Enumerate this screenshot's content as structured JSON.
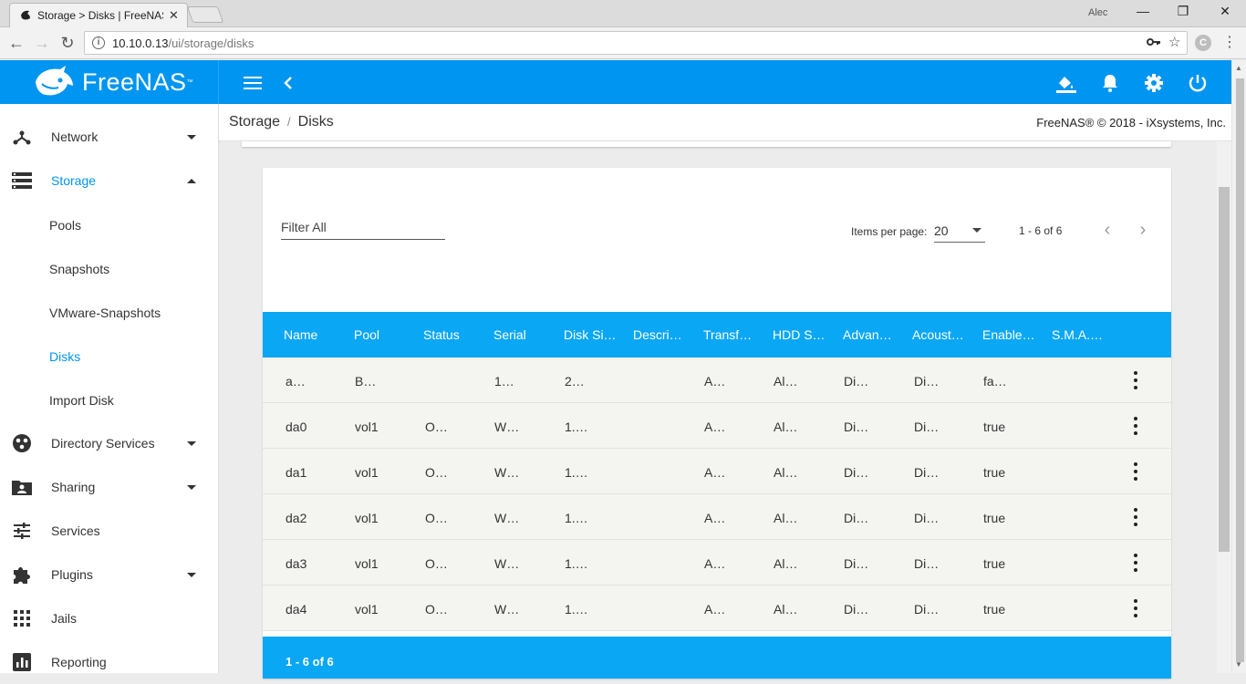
{
  "browser": {
    "tab_title": "Storage > Disks | FreeNAS",
    "user": "Alec",
    "url_host": "10.10.0.13",
    "url_path": "/ui/storage/disks"
  },
  "app": {
    "brand": "FreeNAS",
    "brand_color": "#0095f0",
    "breadcrumb": [
      "Storage",
      "Disks"
    ],
    "copyright": "FreeNAS® © 2018 - iXsystems, Inc."
  },
  "sidebar": {
    "items": [
      {
        "label": "Network",
        "icon": "network-icon"
      },
      {
        "label": "Storage",
        "icon": "storage-icon"
      },
      {
        "label": "Directory Services",
        "icon": "directory-services-icon"
      },
      {
        "label": "Sharing",
        "icon": "sharing-icon"
      },
      {
        "label": "Services",
        "icon": "services-icon"
      },
      {
        "label": "Plugins",
        "icon": "plugins-icon"
      },
      {
        "label": "Jails",
        "icon": "jails-icon"
      },
      {
        "label": "Reporting",
        "icon": "reporting-icon"
      }
    ],
    "storage_sub": [
      "Pools",
      "Snapshots",
      "VMware-Snapshots",
      "Disks",
      "Import Disk"
    ]
  },
  "table": {
    "filter_placeholder": "Filter All",
    "items_per_page_label": "Items per page:",
    "items_per_page": "20",
    "range": "1 - 6 of 6",
    "footer": "1 - 6 of 6",
    "columns": [
      "Name",
      "Pool",
      "Status",
      "Serial",
      "Disk Si…",
      "Descri…",
      "Transf…",
      "HDD S…",
      "Advan…",
      "Acoust…",
      "Enable…",
      "S.M.A.…"
    ],
    "rows": [
      [
        "a…",
        "B…",
        "",
        "1…",
        "2…",
        "",
        "A…",
        "Al…",
        "Di…",
        "Di…",
        "fa…"
      ],
      [
        "da0",
        "vol1",
        "O…",
        "W…",
        "1.…",
        "",
        "A…",
        "Al…",
        "Di…",
        "Di…",
        "true"
      ],
      [
        "da1",
        "vol1",
        "O…",
        "W…",
        "1.…",
        "",
        "A…",
        "Al…",
        "Di…",
        "Di…",
        "true"
      ],
      [
        "da2",
        "vol1",
        "O…",
        "W…",
        "1.…",
        "",
        "A…",
        "Al…",
        "Di…",
        "Di…",
        "true"
      ],
      [
        "da3",
        "vol1",
        "O…",
        "W…",
        "1.…",
        "",
        "A…",
        "Al…",
        "Di…",
        "Di…",
        "true"
      ],
      [
        "da4",
        "vol1",
        "O…",
        "W…",
        "1.…",
        "",
        "A…",
        "Al…",
        "Di…",
        "Di…",
        "true"
      ]
    ]
  }
}
